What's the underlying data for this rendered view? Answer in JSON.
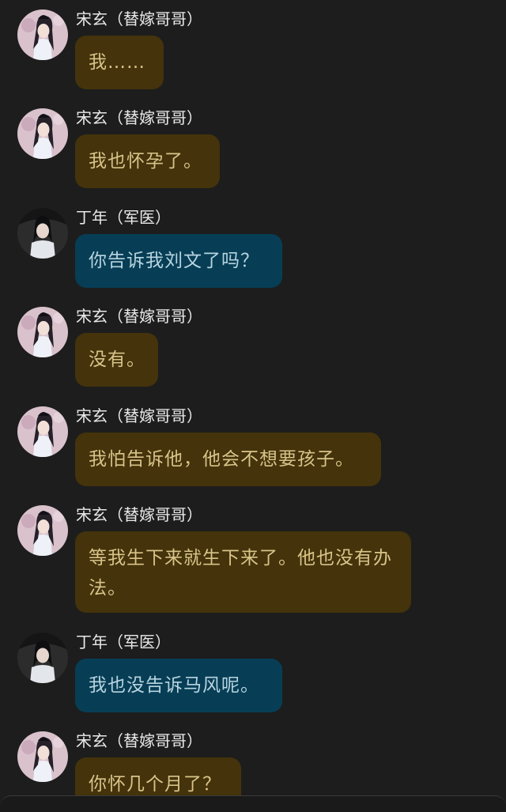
{
  "colors": {
    "background": "#1d1d1d",
    "gold_bubble": "#44330b",
    "gold_text": "#d8c489",
    "blue_bubble": "#073e56",
    "blue_text": "#b8d4e0"
  },
  "messages": [
    {
      "sender": "宋玄（替嫁哥哥）",
      "text": "我……",
      "bubble": "gold",
      "avatar_icon": "songxuan-avatar-icon"
    },
    {
      "sender": "宋玄（替嫁哥哥）",
      "text": "我也怀孕了。",
      "bubble": "gold",
      "avatar_icon": "songxuan-avatar-icon"
    },
    {
      "sender": "丁年（军医）",
      "text": "你告诉我刘文了吗？",
      "bubble": "blue",
      "avatar_icon": "dingnian-avatar-icon"
    },
    {
      "sender": "宋玄（替嫁哥哥）",
      "text": "没有。",
      "bubble": "gold",
      "avatar_icon": "songxuan-avatar-icon"
    },
    {
      "sender": "宋玄（替嫁哥哥）",
      "text": "我怕告诉他，他会不想要孩子。",
      "bubble": "gold",
      "avatar_icon": "songxuan-avatar-icon"
    },
    {
      "sender": "宋玄（替嫁哥哥）",
      "text": "等我生下来就生下来了。他也没有办法。",
      "bubble": "gold",
      "avatar_icon": "songxuan-avatar-icon"
    },
    {
      "sender": "丁年（军医）",
      "text": "我也没告诉马风呢。",
      "bubble": "blue",
      "avatar_icon": "dingnian-avatar-icon"
    },
    {
      "sender": "宋玄（替嫁哥哥）",
      "text": "你怀几个月了？",
      "bubble": "gold",
      "avatar_icon": "songxuan-avatar-icon"
    }
  ]
}
